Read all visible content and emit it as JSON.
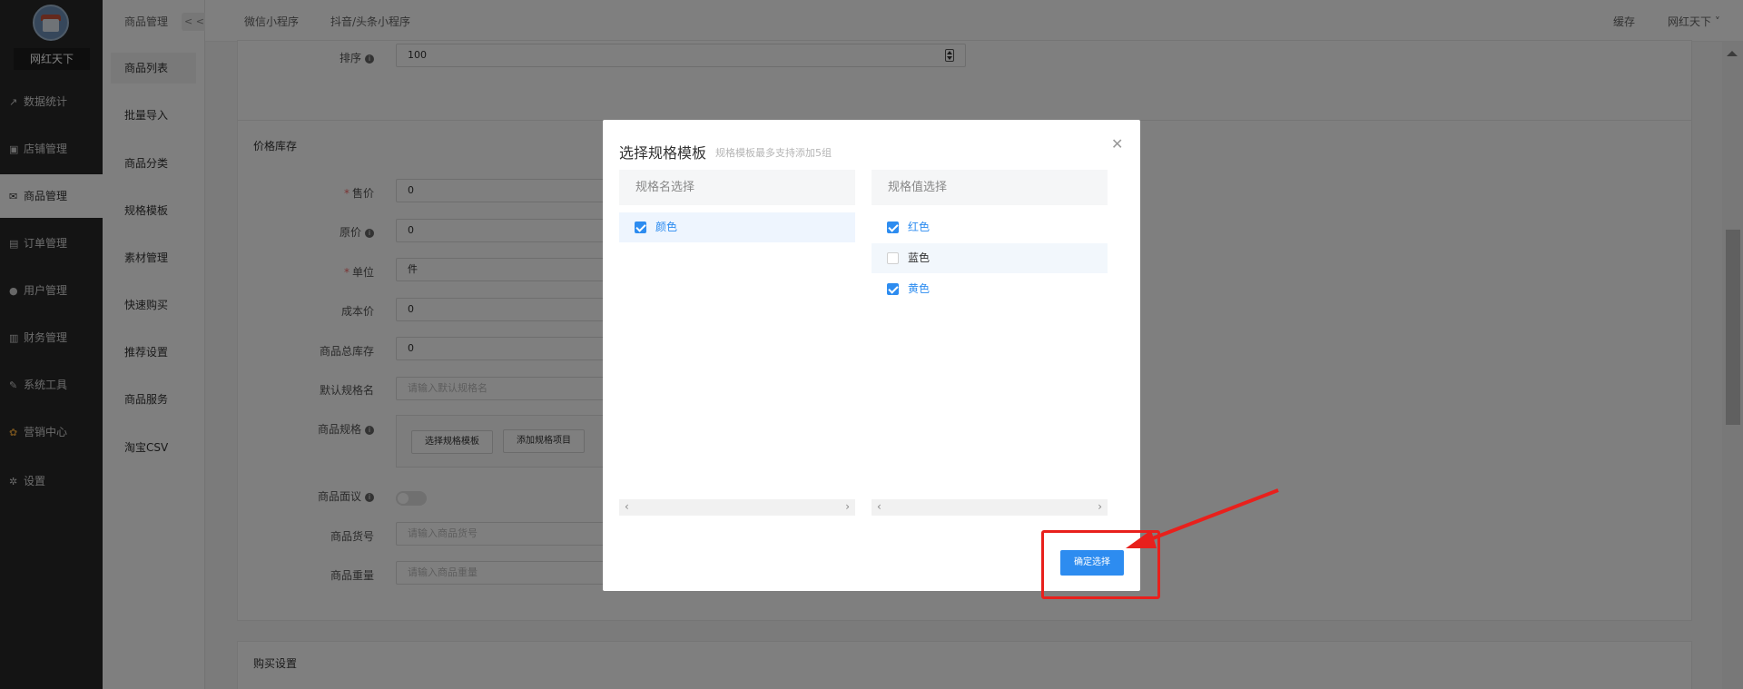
{
  "sidebar": {
    "store_name": "网红天下",
    "items": [
      {
        "label": "数据统计",
        "icon": "chart-icon"
      },
      {
        "label": "店铺管理",
        "icon": "shop-icon"
      },
      {
        "label": "商品管理",
        "icon": "goods-icon",
        "active": true
      },
      {
        "label": "订单管理",
        "icon": "order-icon"
      },
      {
        "label": "用户管理",
        "icon": "user-icon"
      },
      {
        "label": "财务管理",
        "icon": "finance-icon"
      },
      {
        "label": "系统工具",
        "icon": "wrench-icon"
      },
      {
        "label": "营销中心",
        "icon": "marketing-icon"
      },
      {
        "label": "设置",
        "icon": "gear-icon"
      }
    ]
  },
  "submenu": {
    "title": "商品管理",
    "collapse_label": "< <",
    "items": [
      {
        "label": "商品列表",
        "active": true
      },
      {
        "label": "批量导入"
      },
      {
        "label": "商品分类"
      },
      {
        "label": "规格模板"
      },
      {
        "label": "素材管理"
      },
      {
        "label": "快速购买"
      },
      {
        "label": "推荐设置"
      },
      {
        "label": "商品服务"
      },
      {
        "label": "淘宝CSV"
      }
    ]
  },
  "topbar": {
    "tabs": [
      "微信小程序",
      "抖音/头条小程序"
    ],
    "cache_label": "缓存",
    "user_label": "网红天下"
  },
  "form": {
    "sort": {
      "label": "排序",
      "value": "100"
    },
    "price_section_title": "价格库存",
    "fields": [
      {
        "label": "售价",
        "required": true,
        "value": "0"
      },
      {
        "label": "原价",
        "info": true,
        "value": "0"
      },
      {
        "label": "单位",
        "required": true,
        "value": "件"
      },
      {
        "label": "成本价",
        "value": "0"
      },
      {
        "label": "商品总库存",
        "value": "0"
      },
      {
        "label": "默认规格名",
        "placeholder": "请输入默认规格名"
      }
    ],
    "spec": {
      "label": "商品规格",
      "btn_template": "选择规格模板",
      "btn_add": "添加规格项目"
    },
    "negotiable_label": "商品面议",
    "sku_label": "商品货号",
    "sku_placeholder": "请输入商品货号",
    "weight_label": "商品重量",
    "weight_placeholder": "请输入商品重量",
    "buy_section_title": "购买设置"
  },
  "modal": {
    "title": "选择规格模板",
    "subtitle": "规格模板最多支持添加5组",
    "name_header": "规格名选择",
    "value_header": "规格值选择",
    "names": [
      {
        "label": "颜色",
        "checked": true
      }
    ],
    "values": [
      {
        "label": "红色",
        "checked": true
      },
      {
        "label": "蓝色",
        "checked": false
      },
      {
        "label": "黄色",
        "checked": true
      }
    ],
    "confirm_label": "确定选择"
  },
  "colors": {
    "accent": "#2d8cf0",
    "annotation_red": "#e8201c",
    "sidebar_bg": "#282828"
  }
}
